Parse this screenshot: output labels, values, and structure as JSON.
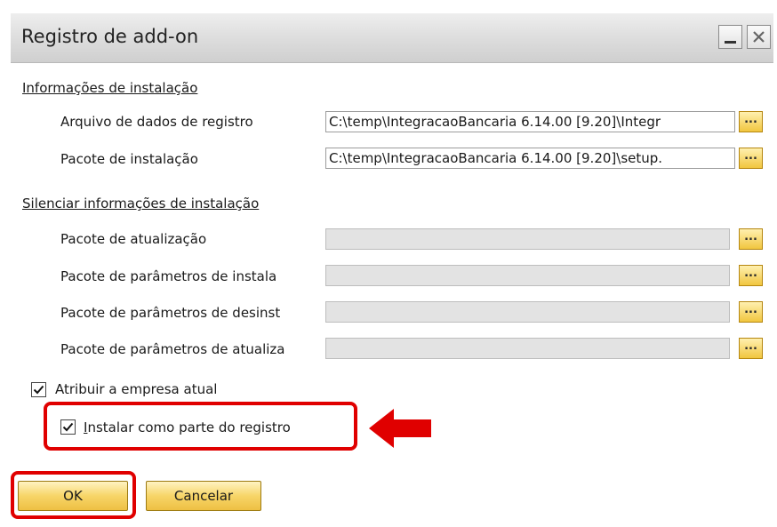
{
  "window": {
    "title": "Registro de add-on",
    "minimize_icon": "minimize-icon",
    "close_icon": "close-icon"
  },
  "install_info": {
    "section_title": "Informações de instalação",
    "rows": [
      {
        "label": "Arquivo de dados de registro",
        "value": "C:\\temp\\IntegracaoBancaria 6.14.00 [9.20]\\Integr",
        "browse_label": "..."
      },
      {
        "label": "Pacote de instalação",
        "value": "C:\\temp\\IntegracaoBancaria 6.14.00 [9.20]\\setup.",
        "browse_label": "..."
      }
    ]
  },
  "silent_info": {
    "section_title": "Silenciar informações de instalação",
    "rows": [
      {
        "label": "Pacote de atualização",
        "value": "",
        "browse_label": "..."
      },
      {
        "label": "Pacote de parâmetros de instala",
        "value": "",
        "browse_label": "..."
      },
      {
        "label": "Pacote de parâmetros de desinst",
        "value": "",
        "browse_label": "..."
      },
      {
        "label": "Pacote de parâmetros de atualiza",
        "value": "",
        "browse_label": "..."
      }
    ]
  },
  "options": {
    "assign_company": {
      "label": "Atribuir a empresa atual",
      "checked": true
    },
    "install_as_part": {
      "label_first": "I",
      "label_rest": "nstalar como parte do registro",
      "checked": true
    }
  },
  "buttons": {
    "ok": "OK",
    "cancel": "Cancelar"
  },
  "annotations": {
    "highlight_color": "#e00000",
    "arrow_icon": "red-left-arrow-icon"
  }
}
